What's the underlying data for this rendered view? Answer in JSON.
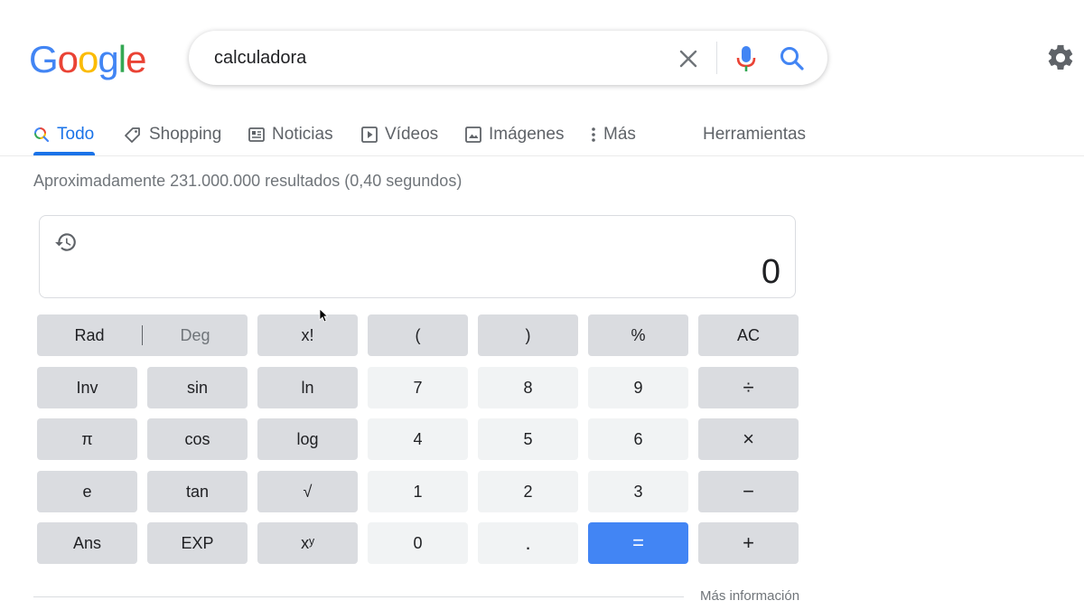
{
  "logo": {
    "letters": [
      "G",
      "o",
      "o",
      "g",
      "l",
      "e"
    ],
    "colors": [
      "#4285f4",
      "#ea4335",
      "#fbbc05",
      "#4285f4",
      "#34a853",
      "#ea4335"
    ]
  },
  "search": {
    "value": "calculadora"
  },
  "tabs": [
    {
      "label": "Todo",
      "icon": "search-icon"
    },
    {
      "label": "Shopping",
      "icon": "tag-icon"
    },
    {
      "label": "Noticias",
      "icon": "newspaper-icon"
    },
    {
      "label": "Vídeos",
      "icon": "play-icon"
    },
    {
      "label": "Imágenes",
      "icon": "image-icon"
    },
    {
      "label": "Más",
      "icon": "more-vert-icon"
    },
    {
      "label": "Herramientas",
      "icon": ""
    }
  ],
  "result_stats": "Aproximadamente 231.000.000 resultados (0,40 segundos)",
  "calculator": {
    "display": "0",
    "keys": {
      "rad": "Rad",
      "deg": "Deg",
      "fact": "x!",
      "lparen": "(",
      "rparen": ")",
      "percent": "%",
      "ac": "AC",
      "inv": "Inv",
      "sin": "sin",
      "ln": "ln",
      "k7": "7",
      "k8": "8",
      "k9": "9",
      "div": "÷",
      "pi": "π",
      "cos": "cos",
      "log": "log",
      "k4": "4",
      "k5": "5",
      "k6": "6",
      "mul": "×",
      "e": "e",
      "tan": "tan",
      "sqrt": "√",
      "k1": "1",
      "k2": "2",
      "k3": "3",
      "sub": "−",
      "ans": "Ans",
      "exp": "EXP",
      "pow": "xʸ",
      "k0": "0",
      "dot": ".",
      "eq": "=",
      "add": "+"
    }
  },
  "more_info": "Más información",
  "colors": {
    "accent": "#1a73e8",
    "equals": "#4285f4"
  }
}
